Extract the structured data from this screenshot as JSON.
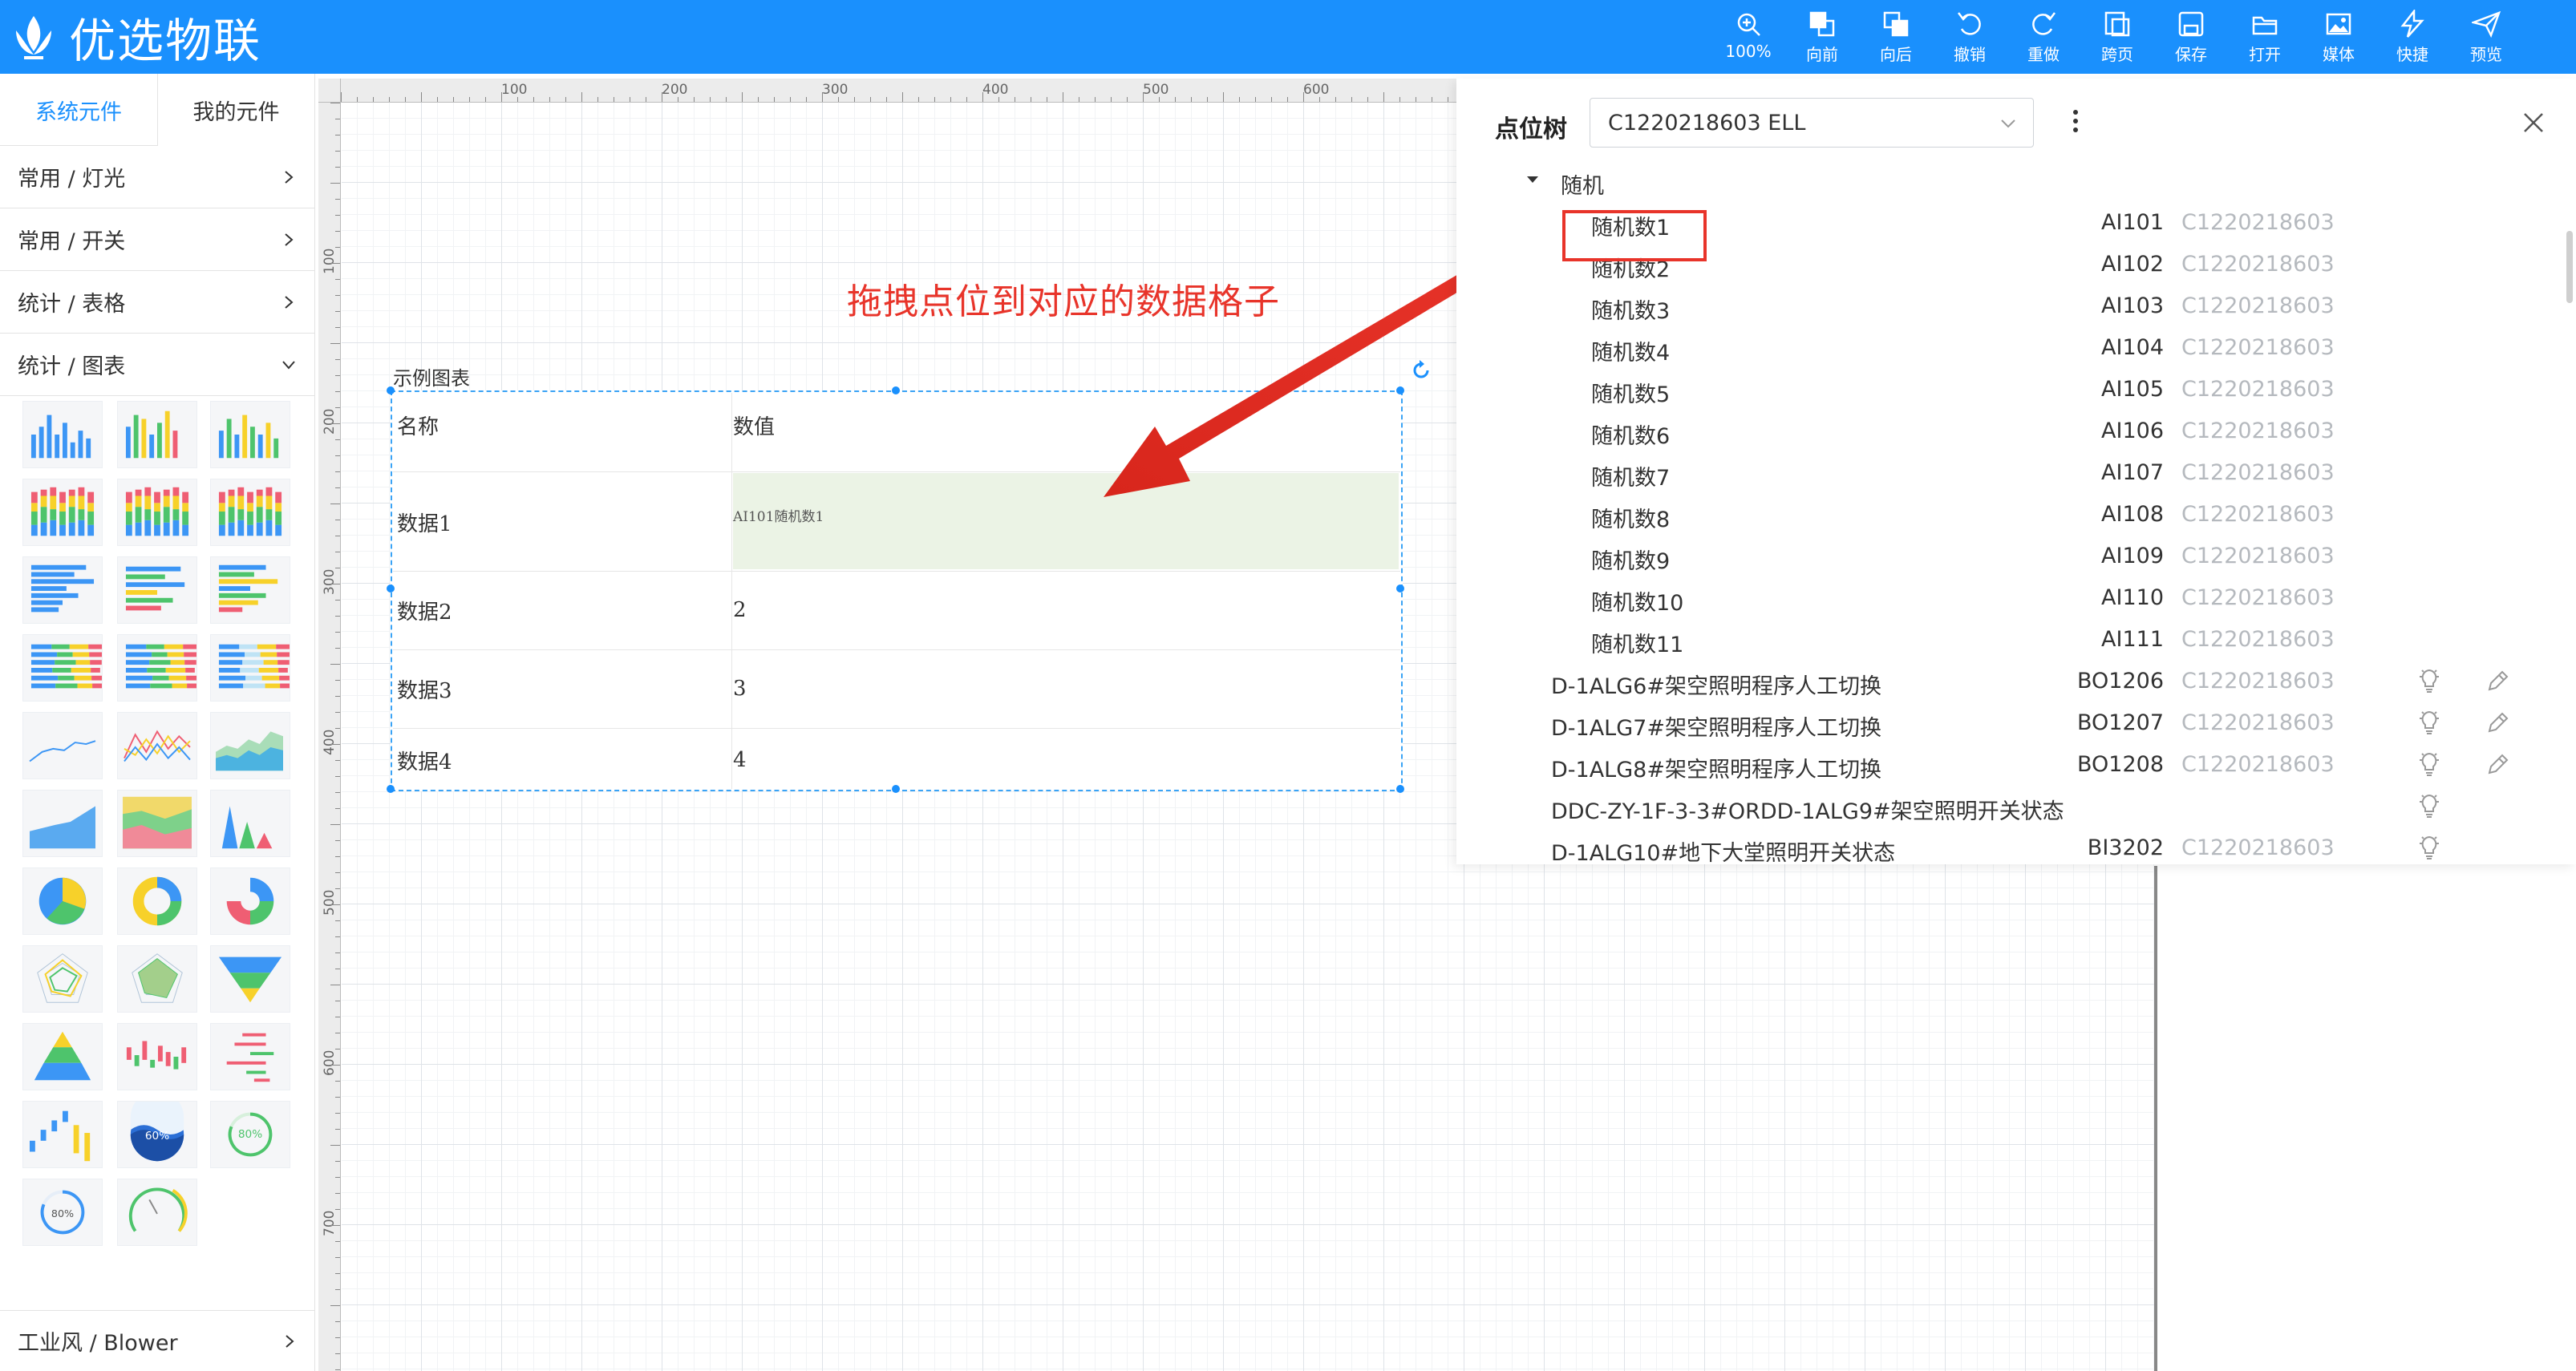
{
  "app": {
    "title": "优选物联"
  },
  "toolbar": {
    "items": [
      {
        "label": "100%",
        "icon": "zoom-in-icon"
      },
      {
        "label": "向前",
        "icon": "bring-forward-icon"
      },
      {
        "label": "向后",
        "icon": "send-backward-icon"
      },
      {
        "label": "撤销",
        "icon": "undo-icon"
      },
      {
        "label": "重做",
        "icon": "redo-icon"
      },
      {
        "label": "跨页",
        "icon": "cross-page-icon"
      },
      {
        "label": "保存",
        "icon": "save-icon"
      },
      {
        "label": "打开",
        "icon": "folder-open-icon"
      },
      {
        "label": "媒体",
        "icon": "media-icon"
      },
      {
        "label": "快捷",
        "icon": "lightning-icon"
      },
      {
        "label": "预览",
        "icon": "send-icon"
      }
    ]
  },
  "sidebar": {
    "tabs": [
      {
        "label": "系统元件"
      },
      {
        "label": "我的元件"
      }
    ],
    "categories": [
      {
        "label": "常用 / 灯光"
      },
      {
        "label": "常用 / 开关"
      },
      {
        "label": "统计 / 表格"
      },
      {
        "label": "统计 / 图表"
      }
    ],
    "gauge_labels": [
      "60%",
      "80%",
      "80%"
    ],
    "bottom_category": "工业风 / Blower"
  },
  "rulers": {
    "top": [
      "100",
      "200",
      "300",
      "400",
      "500",
      "600"
    ],
    "left": [
      "100",
      "200",
      "300",
      "400",
      "500",
      "600",
      "700"
    ]
  },
  "component": {
    "title": "示例图表",
    "headers": {
      "name": "名称",
      "value": "数值"
    },
    "rows": [
      {
        "name": "数据1",
        "value": "AI101随机数1"
      },
      {
        "name": "数据2",
        "value": "2"
      },
      {
        "name": "数据3",
        "value": "3"
      },
      {
        "name": "数据4",
        "value": "4"
      }
    ]
  },
  "annotation": {
    "text": "拖拽点位到对应的数据格子",
    "color": "#e8342a"
  },
  "panel": {
    "title": "点位树",
    "device": "C1220218603 ELL",
    "group": "随机",
    "points": [
      {
        "name": "随机数1",
        "code": "AI101",
        "device": "C1220218603"
      },
      {
        "name": "随机数2",
        "code": "AI102",
        "device": "C1220218603"
      },
      {
        "name": "随机数3",
        "code": "AI103",
        "device": "C1220218603"
      },
      {
        "name": "随机数4",
        "code": "AI104",
        "device": "C1220218603"
      },
      {
        "name": "随机数5",
        "code": "AI105",
        "device": "C1220218603"
      },
      {
        "name": "随机数6",
        "code": "AI106",
        "device": "C1220218603"
      },
      {
        "name": "随机数7",
        "code": "AI107",
        "device": "C1220218603"
      },
      {
        "name": "随机数8",
        "code": "AI108",
        "device": "C1220218603"
      },
      {
        "name": "随机数9",
        "code": "AI109",
        "device": "C1220218603"
      },
      {
        "name": "随机数10",
        "code": "AI110",
        "device": "C1220218603"
      },
      {
        "name": "随机数11",
        "code": "AI111",
        "device": "C1220218603"
      }
    ],
    "other_points": [
      {
        "name": "D-1ALG6#架空照明程序人工切换",
        "code": "BO1206",
        "device": "C1220218603",
        "bulb": true,
        "edit": true
      },
      {
        "name": "D-1ALG7#架空照明程序人工切换",
        "code": "BO1207",
        "device": "C1220218603",
        "bulb": true,
        "edit": true
      },
      {
        "name": "D-1ALG8#架空照明程序人工切换",
        "code": "BO1208",
        "device": "C1220218603",
        "bulb": true,
        "edit": true
      },
      {
        "name": "DDC-ZY-1F-3-3#ORDD-1ALG9#架空照明开关状态",
        "code": "",
        "device": "",
        "bulb": true,
        "edit": false
      },
      {
        "name": "D-1ALG10#地下大堂照明开关状态",
        "code": "BI3202",
        "device": "C1220218603",
        "bulb": true,
        "edit": false
      }
    ]
  },
  "colors": {
    "header": "#1a90fd",
    "accent": "#1a90fd",
    "highlight": "#ebf3e5",
    "alert": "#e8342a"
  }
}
